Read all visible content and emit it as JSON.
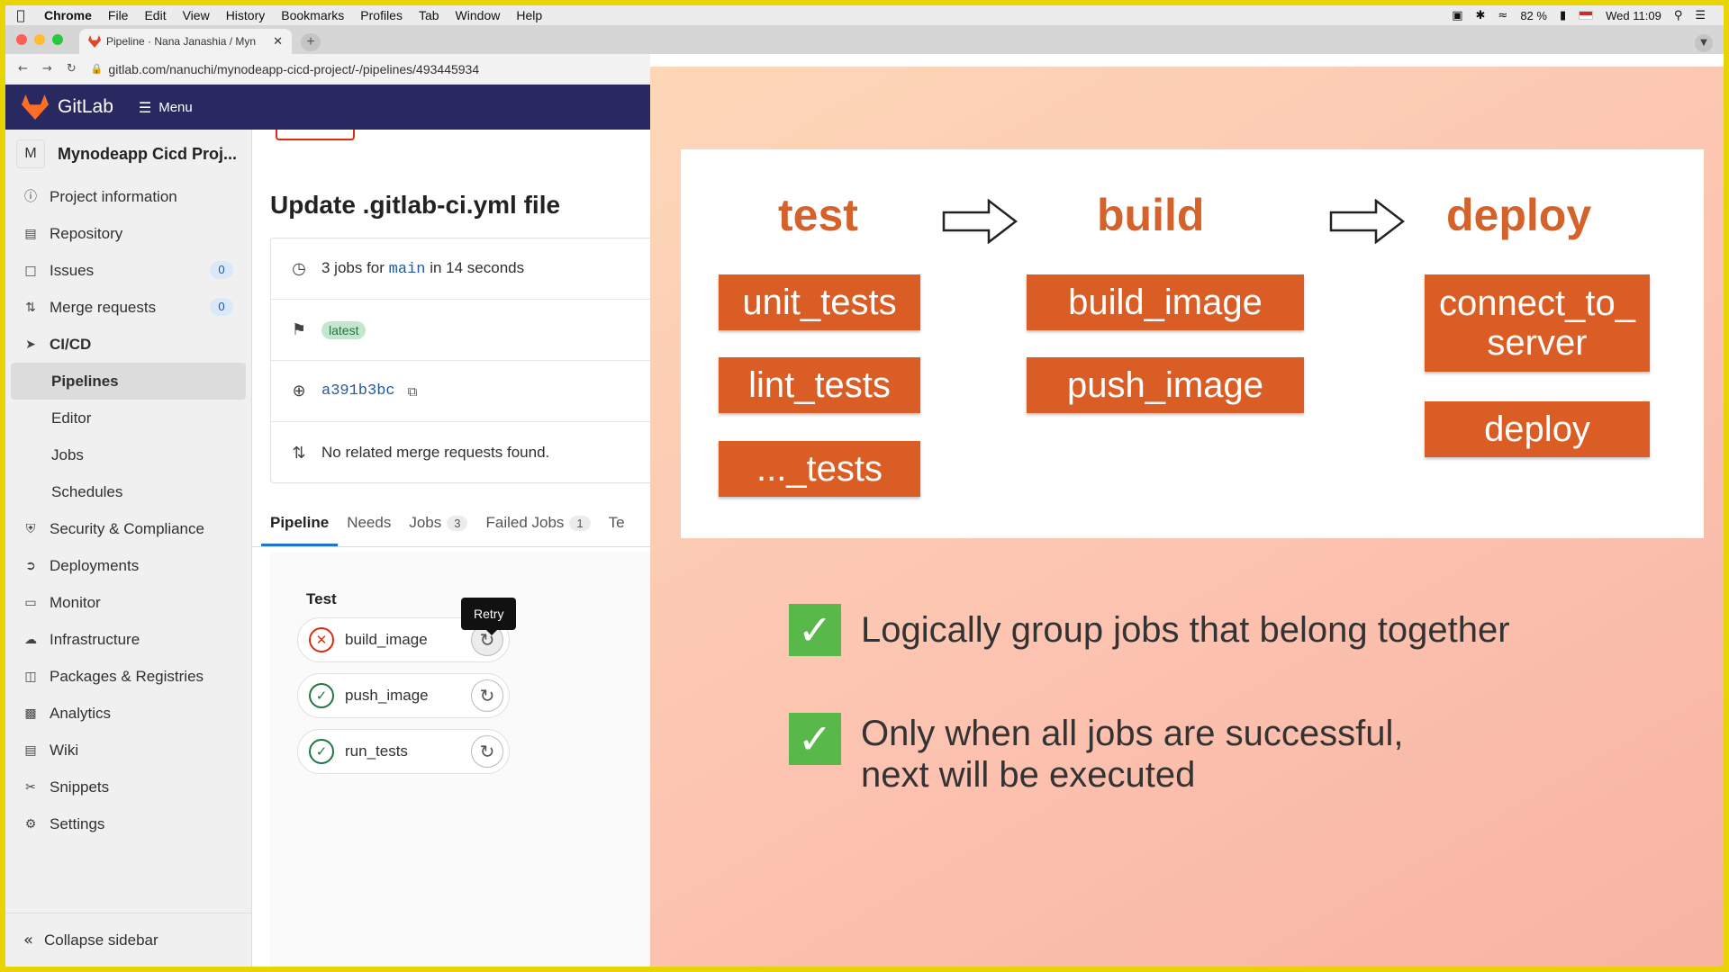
{
  "menubar": {
    "app": "Chrome",
    "items": [
      "File",
      "Edit",
      "View",
      "History",
      "Bookmarks",
      "Profiles",
      "Tab",
      "Window",
      "Help"
    ],
    "battery": "82 %",
    "clock": "Wed 11:09"
  },
  "browser": {
    "tab_title": "Pipeline · Nana Janashia / Myn",
    "url": "gitlab.com/nanuchi/mynodeapp-cicd-project/-/pipelines/493445934"
  },
  "gitlab": {
    "logo_text": "GitLab",
    "menu_label": "Menu",
    "project_initial": "M",
    "project_name": "Mynodeapp Cicd Proj...",
    "nav": [
      {
        "label": "Project information",
        "icon": "info-icon"
      },
      {
        "label": "Repository",
        "icon": "book-icon"
      },
      {
        "label": "Issues",
        "icon": "issues-icon",
        "badge": "0"
      },
      {
        "label": "Merge requests",
        "icon": "merge-request-icon",
        "badge": "0"
      },
      {
        "label": "CI/CD",
        "icon": "rocket-icon"
      },
      {
        "label": "Pipelines"
      },
      {
        "label": "Editor"
      },
      {
        "label": "Jobs"
      },
      {
        "label": "Schedules"
      },
      {
        "label": "Security & Compliance",
        "icon": "shield-icon"
      },
      {
        "label": "Deployments",
        "icon": "deployments-icon"
      },
      {
        "label": "Monitor",
        "icon": "monitor-icon"
      },
      {
        "label": "Infrastructure",
        "icon": "cloud-icon"
      },
      {
        "label": "Packages & Registries",
        "icon": "package-icon"
      },
      {
        "label": "Analytics",
        "icon": "chart-icon"
      },
      {
        "label": "Wiki",
        "icon": "wiki-icon"
      },
      {
        "label": "Snippets",
        "icon": "scissors-icon"
      },
      {
        "label": "Settings",
        "icon": "gear-icon"
      }
    ],
    "collapse_label": "Collapse sidebar",
    "commit_title": "Update .gitlab-ci.yml file",
    "info": {
      "jobs_prefix": "3 jobs for",
      "branch": "main",
      "jobs_suffix": "in 14 seconds",
      "tag": "latest",
      "commit_sha": "a391b3bc",
      "merge_text": "No related merge requests found."
    },
    "tabs": [
      {
        "label": "Pipeline"
      },
      {
        "label": "Needs"
      },
      {
        "label": "Jobs",
        "count": "3"
      },
      {
        "label": "Failed Jobs",
        "count": "1"
      },
      {
        "label": "Te"
      }
    ],
    "stage_name": "Test",
    "tooltip": "Retry",
    "jobs": [
      {
        "name": "build_image",
        "status": "failed"
      },
      {
        "name": "push_image",
        "status": "passed"
      },
      {
        "name": "run_tests",
        "status": "passed"
      }
    ]
  },
  "slide": {
    "stages": [
      "test",
      "build",
      "deploy"
    ],
    "test_jobs": [
      "unit_tests",
      "lint_tests",
      "..._tests"
    ],
    "build_jobs": [
      "build_image",
      "push_image"
    ],
    "deploy_jobs": [
      "connect_to_\nserver",
      "deploy"
    ],
    "bullets": [
      "Logically group jobs that belong together",
      "Only when all jobs are successful,\nnext will be executed"
    ],
    "colors": {
      "accent": "#d95d24",
      "check": "#58b84a"
    }
  }
}
